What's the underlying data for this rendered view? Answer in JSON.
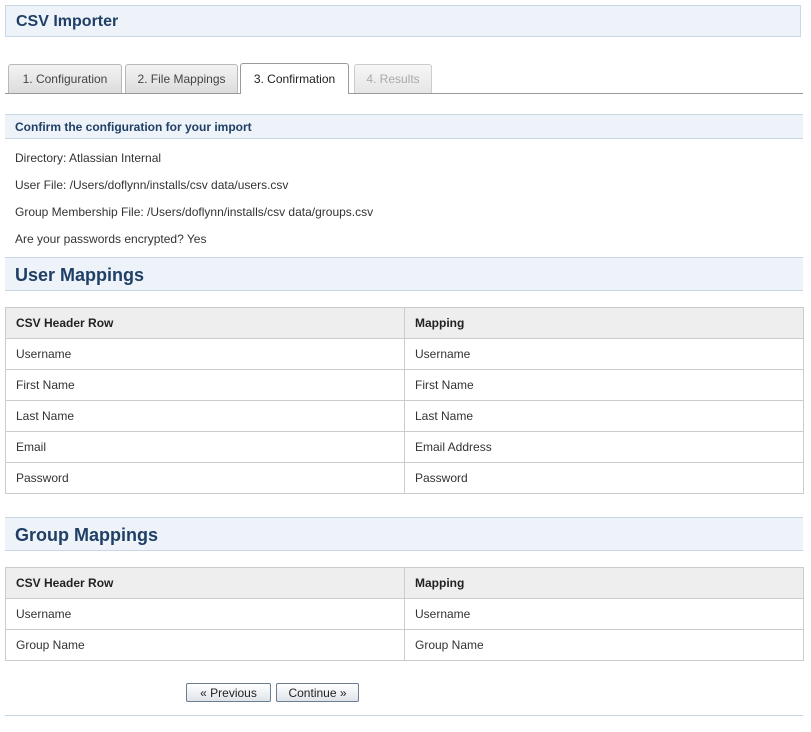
{
  "header": {
    "title": "CSV Importer"
  },
  "tabs": [
    {
      "label": "1.  Configuration",
      "state": "normal"
    },
    {
      "label": "2.  File Mappings",
      "state": "normal"
    },
    {
      "label": "3. Confirmation",
      "state": "active"
    },
    {
      "label": "4. Results",
      "state": "disabled"
    }
  ],
  "confirm": {
    "heading": "Confirm the configuration for your import",
    "directory": "Directory: Atlassian Internal",
    "user_file": "User File: /Users/doflynn/installs/csv data/users.csv",
    "group_file": "Group Membership File: /Users/doflynn/installs/csv data/groups.csv",
    "passwords": "Are your passwords encrypted? Yes"
  },
  "user_mappings": {
    "title": "User Mappings",
    "col_header": "CSV Header Row",
    "col_mapping": "Mapping",
    "rows": [
      [
        "Username",
        "Username"
      ],
      [
        "First Name",
        "First Name"
      ],
      [
        "Last Name",
        "Last Name"
      ],
      [
        "Email",
        "Email Address"
      ],
      [
        "Password",
        "Password"
      ]
    ]
  },
  "group_mappings": {
    "title": "Group Mappings",
    "col_header": "CSV Header Row",
    "col_mapping": "Mapping",
    "rows": [
      [
        "Username",
        "Username"
      ],
      [
        "Group Name",
        "Group Name"
      ]
    ]
  },
  "buttons": {
    "previous": "« Previous",
    "continue": "Continue »"
  },
  "colors": {
    "accent_text": "#1f3f66",
    "panel_bg": "#eef3f9",
    "panel_border": "#c8d6e6"
  }
}
